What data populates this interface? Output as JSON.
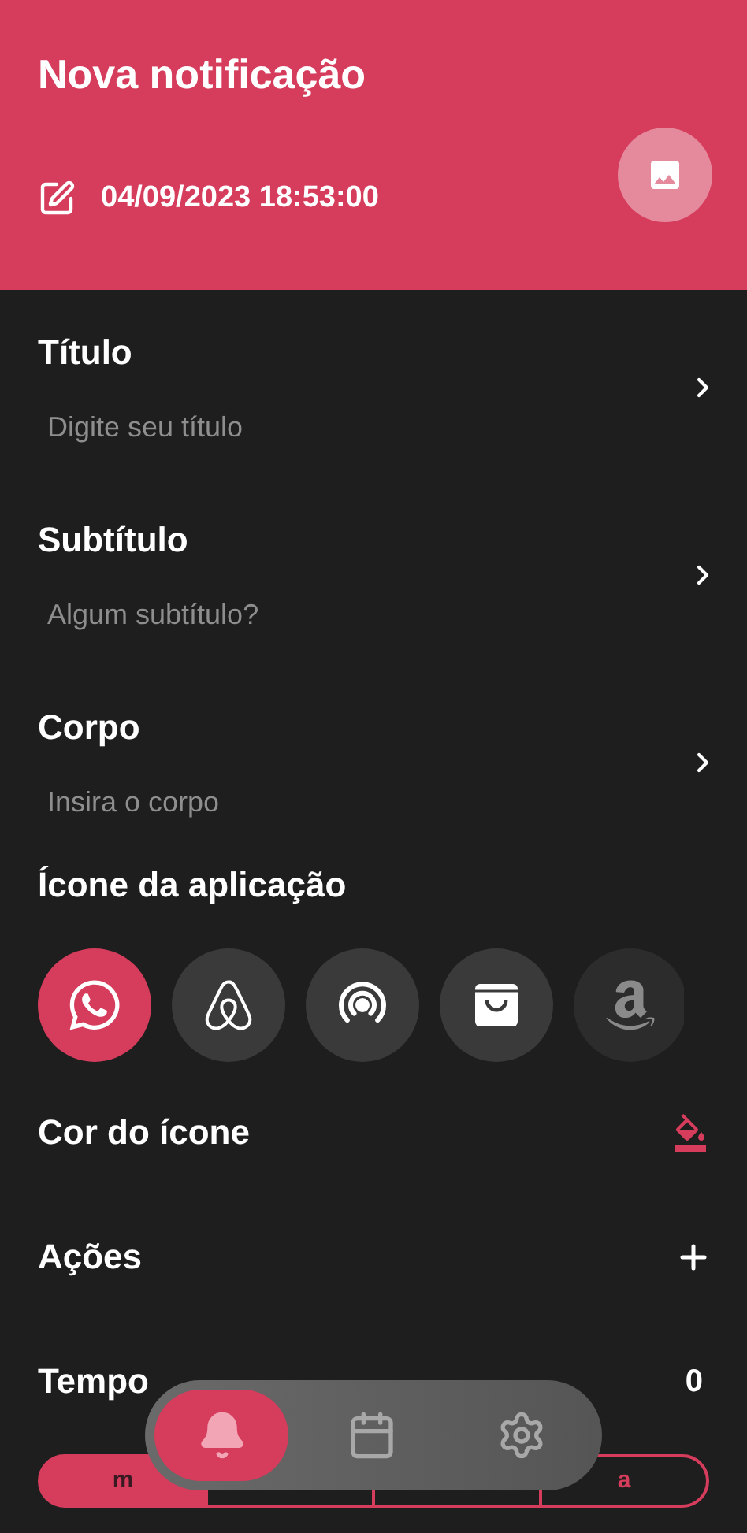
{
  "header": {
    "title": "Nova notificação",
    "datetime": "04/09/2023 18:53:00"
  },
  "fields": [
    {
      "label": "Título",
      "placeholder": "Digite seu título"
    },
    {
      "label": "Subtítulo",
      "placeholder": "Algum subtítulo?"
    },
    {
      "label": "Corpo",
      "placeholder": "Insira o corpo"
    }
  ],
  "app_icon": {
    "title": "Ícone da aplicação",
    "icons": [
      {
        "kind": "chat",
        "selected": true
      },
      {
        "kind": "loop",
        "selected": false
      },
      {
        "kind": "rings",
        "selected": false
      },
      {
        "kind": "bag",
        "selected": false
      },
      {
        "kind": "letter",
        "selected": false
      }
    ]
  },
  "icon_color": {
    "label": "Cor do ícone",
    "color": "#d63c5c"
  },
  "actions": {
    "label": "Ações"
  },
  "time": {
    "label": "Tempo",
    "value": "0",
    "units": [
      {
        "label": "m",
        "selected": true
      },
      {
        "selected": false
      },
      {
        "selected": false
      },
      {
        "label": "a",
        "selected": false
      }
    ]
  },
  "nav": [
    {
      "kind": "bell",
      "selected": true
    },
    {
      "kind": "calendar",
      "selected": false
    },
    {
      "kind": "settings",
      "selected": false
    }
  ]
}
